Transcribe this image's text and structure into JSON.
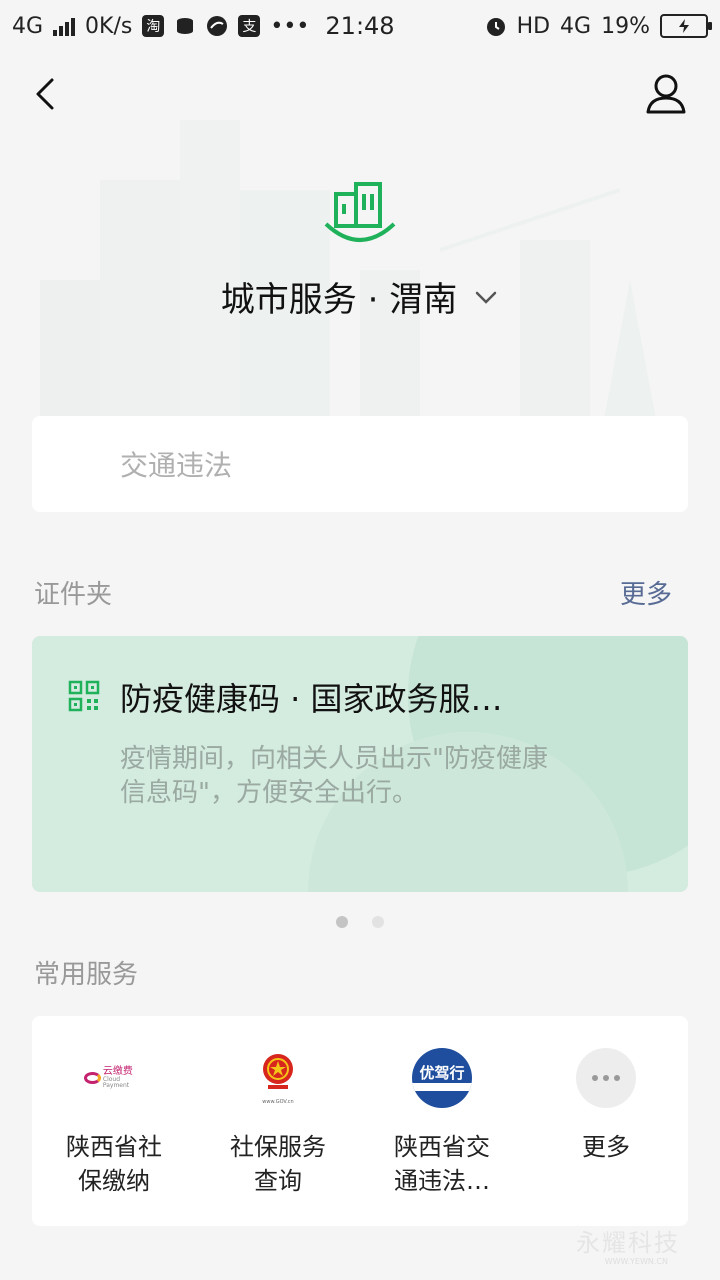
{
  "status_bar": {
    "network": "4G",
    "speed": "0K/s",
    "app_icons": [
      "taobao-icon",
      "usb-icon",
      "bird-icon",
      "alipay-icon"
    ],
    "overflow": "•••",
    "time": "21:48",
    "alarm": "alarm-icon",
    "hd": "HD",
    "network_right": "4G",
    "battery": "19%"
  },
  "header": {
    "back": "back-arrow-icon",
    "profile": "profile-icon"
  },
  "city": {
    "title": "城市服务 · 渭南",
    "logo": "city-buildings-icon"
  },
  "search": {
    "placeholder": "交通违法"
  },
  "certificates": {
    "label": "证件夹",
    "more": "更多",
    "card": {
      "icon": "qr-code-icon",
      "title": "防疫健康码 · 国家政务服…",
      "desc": "疫情期间，向相关人员出示\"防疫健康信息码\"，方便安全出行。"
    },
    "pages": 2,
    "active_page": 1
  },
  "services": {
    "label": "常用服务",
    "items": [
      {
        "label": "陕西省社\n保缴纳",
        "icon": "yunjiaofei-icon",
        "logo_text": "云缴费",
        "logo_sub": "Cloud Payment"
      },
      {
        "label": "社保服务\n查询",
        "icon": "national-emblem-icon",
        "logo_sub": "www.GOV.cn"
      },
      {
        "label": "陕西省交\n通违法…",
        "icon": "youjiaxing-icon",
        "logo_text": "优驾行"
      },
      {
        "label": "更多",
        "icon": "more-dots-icon"
      }
    ]
  },
  "watermark": {
    "text": "永耀科技",
    "sub": "WWW.YEWN.CN"
  },
  "colors": {
    "accent_green": "#20b25a",
    "link_blue": "#576b95",
    "card_bg": "#d4ebe0"
  }
}
